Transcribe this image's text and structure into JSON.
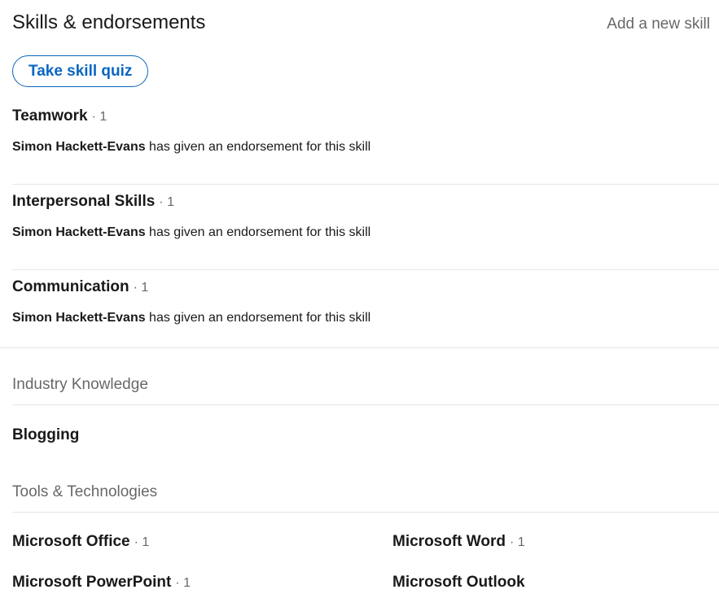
{
  "header": {
    "title": "Skills & endorsements",
    "add_skill": "Add a new skill",
    "quiz_button": "Take skill quiz"
  },
  "top_skills": [
    {
      "name": "Teamwork",
      "count": "· 1",
      "endorser": "Simon Hackett-Evans",
      "endorse_text": " has given an endorsement for this skill"
    },
    {
      "name": "Interpersonal Skills",
      "count": "· 1",
      "endorser": "Simon Hackett-Evans",
      "endorse_text": " has given an endorsement for this skill"
    },
    {
      "name": "Communication",
      "count": "· 1",
      "endorser": "Simon Hackett-Evans",
      "endorse_text": " has given an endorsement for this skill"
    }
  ],
  "categories": {
    "industry": {
      "title": "Industry Knowledge",
      "skills": [
        {
          "name": "Blogging"
        }
      ]
    },
    "tools": {
      "title": "Tools & Technologies",
      "skills": [
        {
          "name": "Microsoft Office",
          "count": "· 1"
        },
        {
          "name": "Microsoft Word",
          "count": "· 1"
        },
        {
          "name": "Microsoft PowerPoint",
          "count": "· 1"
        },
        {
          "name": "Microsoft Outlook"
        }
      ]
    }
  },
  "colors": {
    "accent": "#0a66c2",
    "text_primary": "#1f1f1f",
    "text_secondary": "#666666",
    "divider": "#e6e6e6"
  }
}
